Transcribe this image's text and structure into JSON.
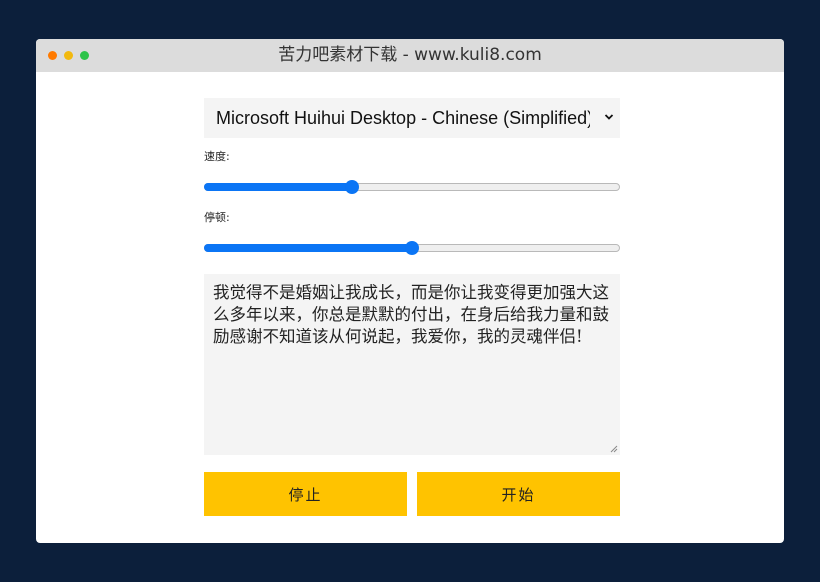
{
  "window": {
    "title": "苦力吧素材下载 - www.kuli8.com",
    "dots": [
      "#ff5f57",
      "#febc2e",
      "#28c840"
    ]
  },
  "voice": {
    "selected": "Microsoft Huihui Desktop - Chinese (Simplified)"
  },
  "rate": {
    "label": "速度:",
    "value": 0.35
  },
  "pitch": {
    "label": "停顿:",
    "value": 0.5
  },
  "text": {
    "value": "我觉得不是婚姻让我成长，而是你让我变得更加强大这么多年以来，你总是默默的付出，在身后给我力量和鼓励感谢不知道该从何说起，我爱你，我的灵魂伴侣!"
  },
  "buttons": {
    "stop": "停止",
    "start": "开始"
  },
  "colors": {
    "accent": "#0b75f5",
    "button": "#ffc300",
    "background": "#0c1f3b"
  }
}
